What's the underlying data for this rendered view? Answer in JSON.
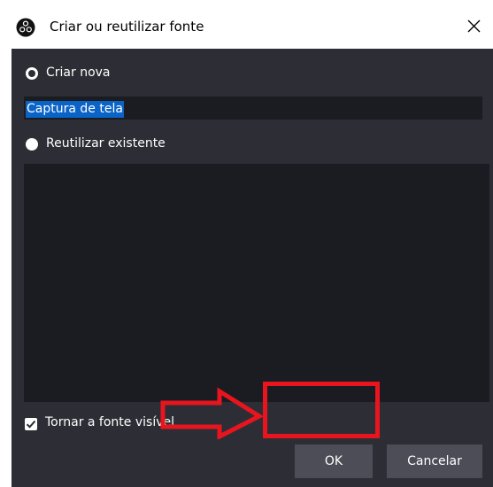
{
  "window": {
    "title": "Criar ou reutilizar fonte",
    "app_icon": "obs-icon",
    "close_icon": "close-icon"
  },
  "options": {
    "create_new_label": "Criar nova",
    "create_new_selected": true,
    "name_value": "Captura de tela",
    "reuse_existing_label": "Reutilizar existente",
    "reuse_existing_selected": false
  },
  "sources_list": {
    "items": []
  },
  "visibility": {
    "label": "Tornar a fonte visível",
    "checked": true
  },
  "buttons": {
    "ok_label": "OK",
    "cancel_label": "Cancelar"
  },
  "annotation": {
    "highlight_color": "#e8141e",
    "arrow_icon": "arrow-right-icon"
  },
  "colors": {
    "background": "#2d2e35",
    "field_background": "#1b1c21",
    "button_background": "#4c4d56",
    "selection": "#0a64c8"
  }
}
